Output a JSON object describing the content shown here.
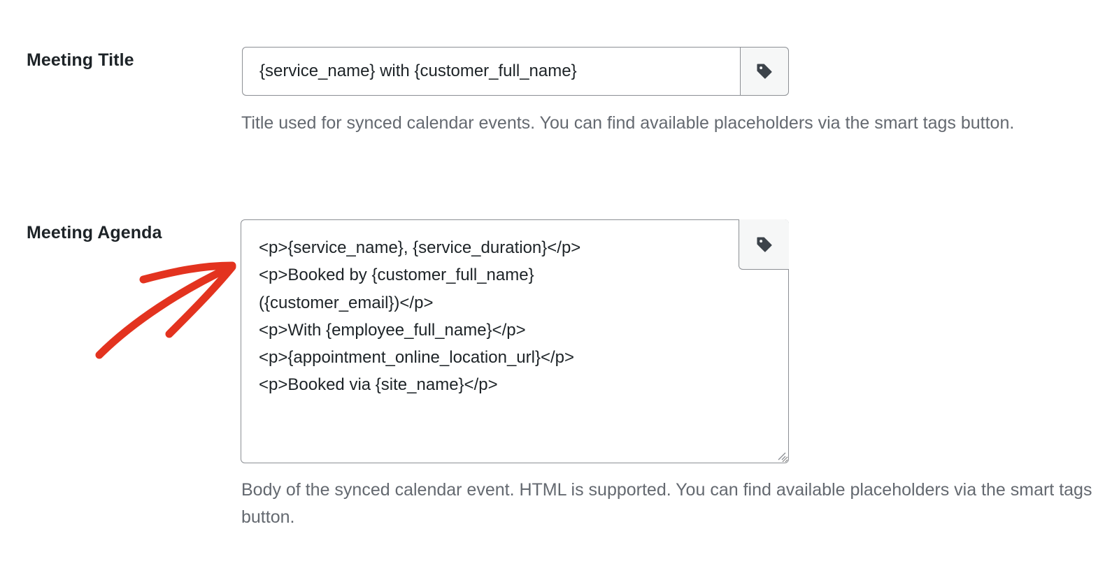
{
  "meeting_title": {
    "label": "Meeting Title",
    "value": "{service_name} with {customer_full_name}",
    "description": "Title used for synced calendar events. You can find available placeholders via the smart tags button."
  },
  "meeting_agenda": {
    "label": "Meeting Agenda",
    "value": "<p>{service_name}, {service_duration}</p>\n<p>Booked by {customer_full_name}\n({customer_email})</p>\n<p>With {employee_full_name}</p>\n<p>{appointment_online_location_url}</p>\n<p>Booked via {site_name}</p>",
    "description": "Body of the synced calendar event. HTML is supported. You can find available placeholders via the smart tags button."
  },
  "icons": {
    "smart_tags": "tag-icon",
    "annotation": "red-arrow-icon",
    "resize": "resize-grip-icon"
  },
  "colors": {
    "text": "#1d2327",
    "muted": "#646970",
    "border": "#8c8f94",
    "button_bg": "#f6f7f7",
    "arrow": "#e3331f"
  }
}
